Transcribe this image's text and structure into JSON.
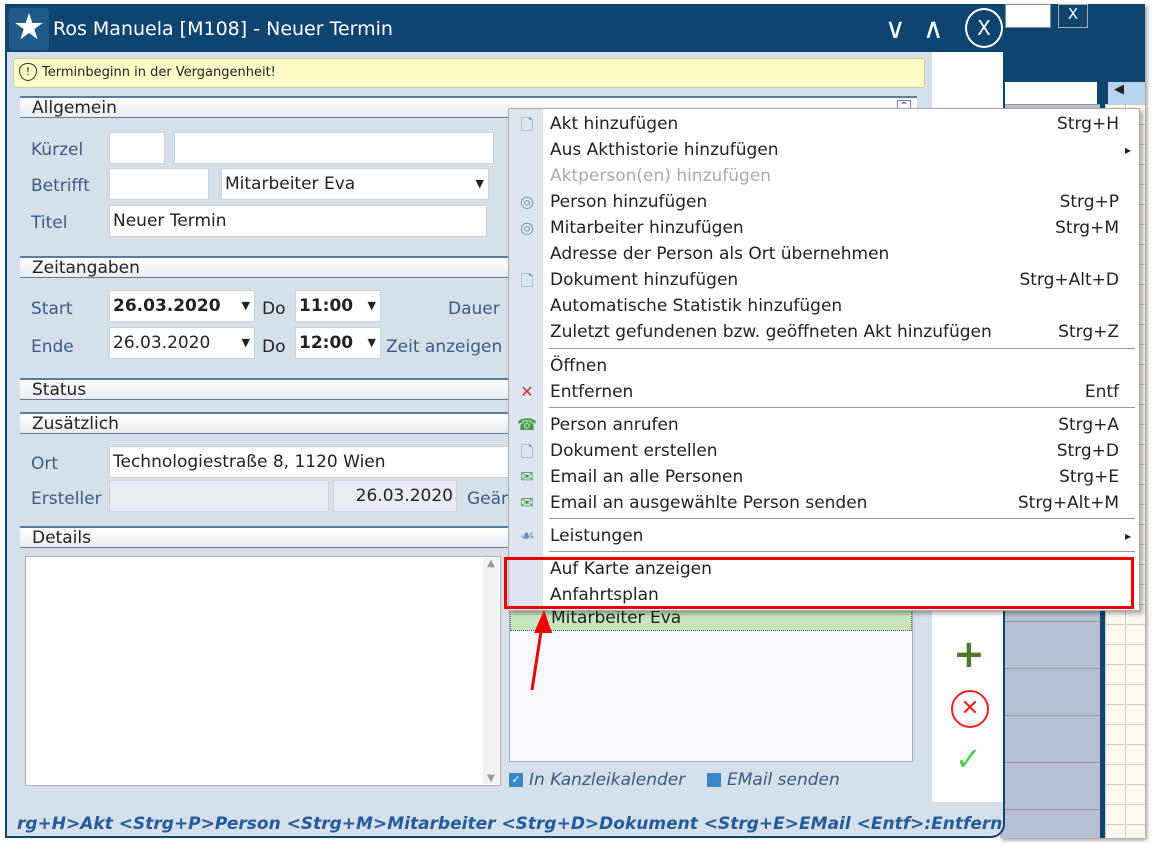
{
  "window": {
    "title": "Ros Manuela [M108] - Neuer Termin",
    "warning": "Terminbeginn in der Vergangenheit!"
  },
  "background_app": {
    "close_label": "X"
  },
  "sections": {
    "allgemein": "Allgemein",
    "zeitangaben": "Zeitangaben",
    "status": "Status",
    "zusaetzlich": "Zusätzlich",
    "details": "Details"
  },
  "allgemein": {
    "kuerzel_label": "Kürzel",
    "betrifft_label": "Betrifft",
    "betrifft_value": "Mitarbeiter Eva",
    "titel_label": "Titel",
    "titel_value": "Neuer Termin"
  },
  "zeit": {
    "start_label": "Start",
    "start_date": "26.03.2020",
    "start_day": "Do",
    "start_time": "11:00",
    "dauer_label": "Dauer",
    "ende_label": "Ende",
    "ende_date": "26.03.2020",
    "ende_day": "Do",
    "ende_time": "12:00",
    "zeit_anzeigen": "Zeit anzeigen a"
  },
  "zusaetzlich": {
    "ort_label": "Ort",
    "ort_value": "Technologiestraße 8, 1120 Wien",
    "ersteller_label": "Ersteller",
    "ersteller_date": "26.03.2020",
    "geaendert_label": "Geän"
  },
  "participants": {
    "item": "Mitarbeiter Eva",
    "in_kanzleikalender": "In Kanzleikalender",
    "in_kanzleikalender_checked": true,
    "email_senden": "EMail senden",
    "email_senden_checked": false
  },
  "context_menu": {
    "items": [
      {
        "label": "Akt hinzufügen",
        "shortcut": "Strg+H",
        "icon": "document-icon"
      },
      {
        "label": "Aus Akthistorie hinzufügen",
        "shortcut": "",
        "submenu": true
      },
      {
        "label": "Aktperson(en) hinzufügen",
        "shortcut": "",
        "disabled": true
      },
      {
        "label": "Person hinzufügen",
        "shortcut": "Strg+P",
        "icon": "person-icon"
      },
      {
        "label": "Mitarbeiter hinzufügen",
        "shortcut": "Strg+M",
        "icon": "person-icon"
      },
      {
        "label": "Adresse der Person als Ort übernehmen",
        "shortcut": ""
      },
      {
        "label": "Dokument hinzufügen",
        "shortcut": "Strg+Alt+D",
        "icon": "document-icon"
      },
      {
        "label": "Automatische Statistik hinzufügen",
        "shortcut": ""
      },
      {
        "label": "Zuletzt gefundenen bzw. geöffneten Akt hinzufügen",
        "shortcut": "Strg+Z"
      },
      {
        "label": "Öffnen",
        "shortcut": ""
      },
      {
        "label": "Entfernen",
        "shortcut": "Entf",
        "icon": "x-icon"
      },
      {
        "label": "Person anrufen",
        "shortcut": "Strg+A",
        "icon": "phone-icon"
      },
      {
        "label": "Dokument erstellen",
        "shortcut": "Strg+D",
        "icon": "document-icon"
      },
      {
        "label": "Email an alle Personen",
        "shortcut": "Strg+E",
        "icon": "mail-icon"
      },
      {
        "label": "Email an ausgewählte Person senden",
        "shortcut": "Strg+Alt+M",
        "icon": "mail-icon"
      },
      {
        "label": "Leistungen",
        "shortcut": "",
        "submenu": true,
        "icon": "hand-icon"
      },
      {
        "label": "Auf Karte anzeigen",
        "shortcut": ""
      },
      {
        "label": "Anfahrtsplan",
        "shortcut": ""
      }
    ],
    "submenu_arrow": "▸"
  },
  "footer": "rg+H>Akt <Strg+P>Person <Strg+M>Mitarbeiter <Strg+D>Dokument <Strg+E>EMail <Entf>:Entfernen <re. Maus>:M",
  "colors": {
    "titlebar": "#0e4570",
    "highlight": "#e00000"
  }
}
